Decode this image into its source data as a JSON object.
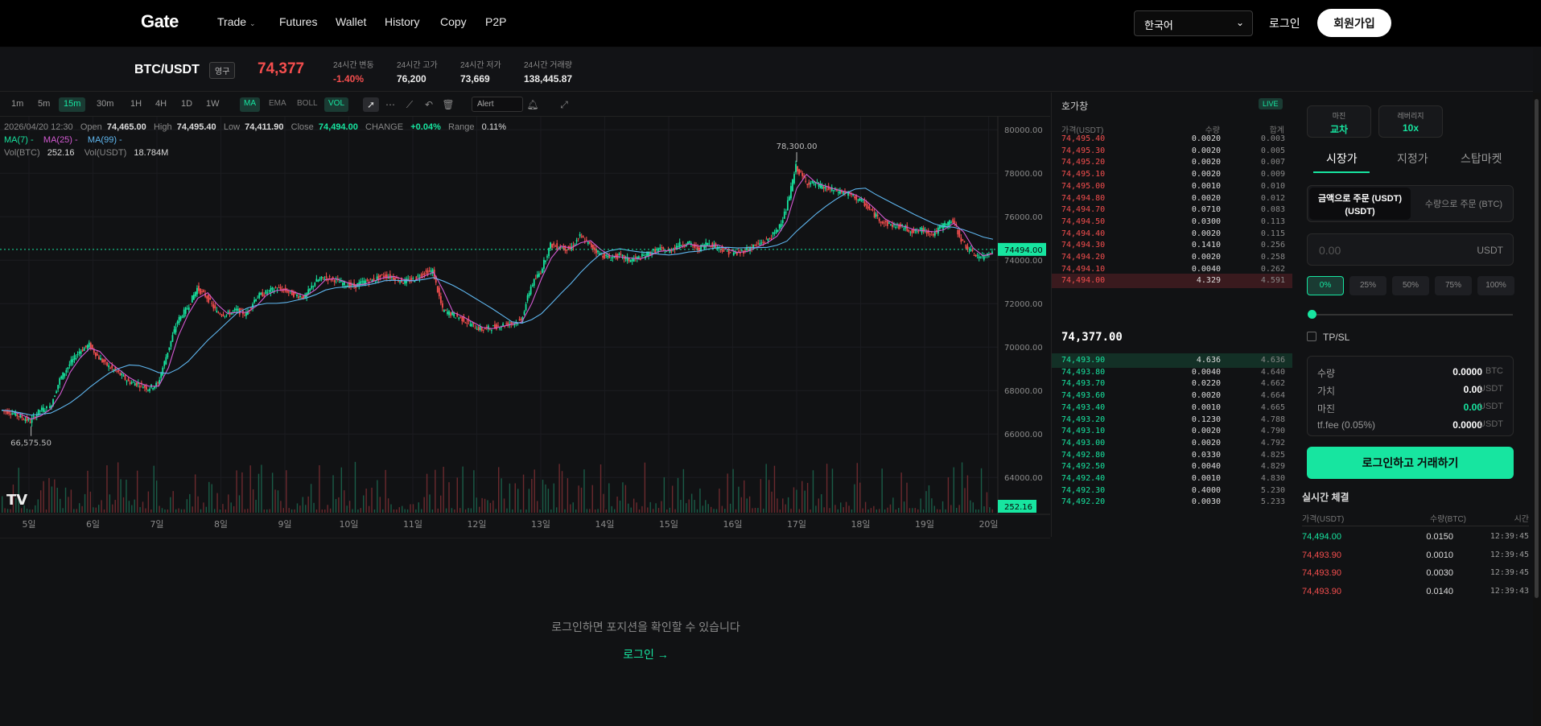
{
  "nav": {
    "logo": "Gate",
    "links": [
      "Trade",
      "Futures",
      "Wallet",
      "History",
      "Copy",
      "P2P"
    ],
    "language": "한국어",
    "login": "로그인",
    "signup": "회원가입"
  },
  "ticker": {
    "pair": "BTC/USDT",
    "contract_badge": "영구",
    "last_price": "74,377",
    "stats": [
      {
        "label": "24시간 변동",
        "value": "-1.40%"
      },
      {
        "label": "24시간 고가",
        "value": "76,200"
      },
      {
        "label": "24시간 저가",
        "value": "73,669"
      },
      {
        "label": "24시간 거래량",
        "value": "138,445.87"
      }
    ]
  },
  "chart_toolbar": {
    "timeframes": [
      "1m",
      "5m",
      "15m",
      "30m",
      "1H",
      "4H",
      "1D",
      "1W"
    ],
    "active_timeframe": "15m",
    "indicators": [
      "MA",
      "EMA",
      "BOLL",
      "VOL"
    ],
    "alert_label": "Alert"
  },
  "chart_info": {
    "date": "2026/04/20 12:30",
    "open_label": "Open",
    "open": "74,465.00",
    "high_label": "High",
    "high": "74,495.40",
    "low_label": "Low",
    "low": "74,411.90",
    "close_label": "Close",
    "close": "74,494.00",
    "change_label": "CHANGE",
    "change": "+0.04%",
    "range_label": "Range",
    "range": "0.11%",
    "ma7": "MA(7) -",
    "ma25": "MA(25) -",
    "ma99": "MA(99) -",
    "vol_btc_label": "Vol(BTC)",
    "vol_btc": "252.16",
    "vol_usdt_label": "Vol(USDT)",
    "vol_usdt": "18.784M"
  },
  "chart_data": {
    "type": "line",
    "title": "",
    "x_ticks": [
      "5일",
      "6일",
      "7일",
      "8일",
      "9일",
      "10일",
      "11일",
      "12일",
      "13일",
      "14일",
      "15일",
      "16일",
      "17일",
      "18일",
      "19일",
      "20일"
    ],
    "y_ticks": [
      "80000.00",
      "78000.00",
      "76000.00",
      "74000.00",
      "72000.00",
      "70000.00",
      "68000.00",
      "66000.00",
      "64000.00"
    ],
    "ylim": [
      62600,
      80600
    ],
    "series": [
      {
        "values": [
          67100,
          67000,
          66800,
          66575.5,
          67100,
          67200,
          68500,
          69200,
          69800,
          70100,
          69500,
          69100,
          68800,
          68400,
          68300,
          68100,
          68300,
          69800,
          71200,
          71800,
          72700,
          72300,
          71600,
          71500,
          71700,
          71500,
          72300,
          72500,
          72700,
          72600,
          72400,
          72300,
          73000,
          73200,
          73100,
          72900,
          72800,
          73000,
          73100,
          73300,
          73200,
          73000,
          73100,
          73400,
          73500,
          71700,
          71500,
          71300,
          71000,
          70800,
          70900,
          71000,
          71100,
          71200,
          72800,
          73500,
          74700,
          74600,
          74500,
          75100,
          74700,
          74300,
          74100,
          74200,
          74000,
          74100,
          74300,
          74500,
          74400,
          74700,
          74800,
          74500,
          74800,
          74600,
          74400,
          74300,
          74500,
          74700,
          74900,
          75300,
          76300,
          78300,
          77600,
          77500,
          77300,
          77200,
          77100,
          76900,
          76600,
          76100,
          75700,
          75600,
          75500,
          75300,
          75400,
          75200,
          75600,
          75800,
          74800,
          74300,
          74100,
          74494
        ]
      }
    ],
    "annotations": [
      "78,300.00",
      "66,575.50"
    ],
    "current_price_label": "74494.00",
    "volume_label": "252.16",
    "grid": true
  },
  "orderbook": {
    "title": "호가창",
    "live": "LIVE",
    "headers": [
      "가격(USDT)",
      "수량",
      "합계"
    ],
    "asks": [
      [
        "74,495.40",
        "0.0020",
        "0.003"
      ],
      [
        "74,495.30",
        "0.0020",
        "0.005"
      ],
      [
        "74,495.20",
        "0.0020",
        "0.007"
      ],
      [
        "74,495.10",
        "0.0020",
        "0.009"
      ],
      [
        "74,495.00",
        "0.0010",
        "0.010"
      ],
      [
        "74,494.80",
        "0.0020",
        "0.012"
      ],
      [
        "74,494.70",
        "0.0710",
        "0.083"
      ],
      [
        "74,494.50",
        "0.0300",
        "0.113"
      ],
      [
        "74,494.40",
        "0.0020",
        "0.115"
      ],
      [
        "74,494.30",
        "0.1410",
        "0.256"
      ],
      [
        "74,494.20",
        "0.0020",
        "0.258"
      ],
      [
        "74,494.10",
        "0.0040",
        "0.262"
      ],
      [
        "74,494.00",
        "4.329",
        "4.591"
      ]
    ],
    "mid_price": "74,377.00",
    "bids": [
      [
        "74,493.90",
        "4.636",
        "4.636"
      ],
      [
        "74,493.80",
        "0.0040",
        "4.640"
      ],
      [
        "74,493.70",
        "0.0220",
        "4.662"
      ],
      [
        "74,493.60",
        "0.0020",
        "4.664"
      ],
      [
        "74,493.40",
        "0.0010",
        "4.665"
      ],
      [
        "74,493.20",
        "0.1230",
        "4.788"
      ],
      [
        "74,493.10",
        "0.0020",
        "4.790"
      ],
      [
        "74,493.00",
        "0.0020",
        "4.792"
      ],
      [
        "74,492.80",
        "0.0330",
        "4.825"
      ],
      [
        "74,492.50",
        "0.0040",
        "4.829"
      ],
      [
        "74,492.40",
        "0.0010",
        "4.830"
      ],
      [
        "74,492.30",
        "0.4000",
        "5.230"
      ],
      [
        "74,492.20",
        "0.0030",
        "5.233"
      ]
    ]
  },
  "trade": {
    "margin_label": "마진",
    "margin_value": "교차",
    "leverage_label": "레버리지",
    "leverage_value": "10x",
    "order_tabs": [
      "시장가",
      "지정가",
      "스탑마켓"
    ],
    "mode_amount": "금액으로 주문 (USDT)",
    "mode_amount_sub": "(USDT)",
    "mode_qty": "수량으로 주문 (BTC)",
    "amount_placeholder": "0.00",
    "amount_unit": "USDT",
    "percents": [
      "0%",
      "25%",
      "50%",
      "75%",
      "100%"
    ],
    "slider_fraction": 0,
    "tpsl": "TP/SL",
    "summary": [
      {
        "key": "수량",
        "value": "0.0000",
        "unit": "BTC"
      },
      {
        "key": "가치",
        "value": "0.00",
        "unit": "USDT"
      },
      {
        "key": "마진",
        "value": "0.00",
        "unit": "USDT"
      },
      {
        "key": "tf.fee (0.05%)",
        "value": "0.0000",
        "unit": "USDT"
      }
    ],
    "button": "로그인하고 거래하기",
    "trades_title": "실시간 체결",
    "trades_headers": [
      "가격(USDT)",
      "수량(BTC)",
      "시간"
    ],
    "trades": [
      {
        "price": "74,494.00",
        "qty": "0.0150",
        "time": "12:39:45",
        "side": "buy"
      },
      {
        "price": "74,493.90",
        "qty": "0.0010",
        "time": "12:39:45",
        "side": "sell"
      },
      {
        "price": "74,493.90",
        "qty": "0.0030",
        "time": "12:39:45",
        "side": "sell"
      },
      {
        "price": "74,493.90",
        "qty": "0.0140",
        "time": "12:39:43",
        "side": "sell"
      }
    ]
  },
  "positions": {
    "message": "로그인하면 포지션을 확인할 수 있습니다",
    "login_link": "로그인 →"
  },
  "colors": {
    "up": "#17e5a0",
    "down": "#f44e4e",
    "ma7": "#17e5a0",
    "ma25": "#d45ad3",
    "ma99": "#5fb7f0"
  }
}
